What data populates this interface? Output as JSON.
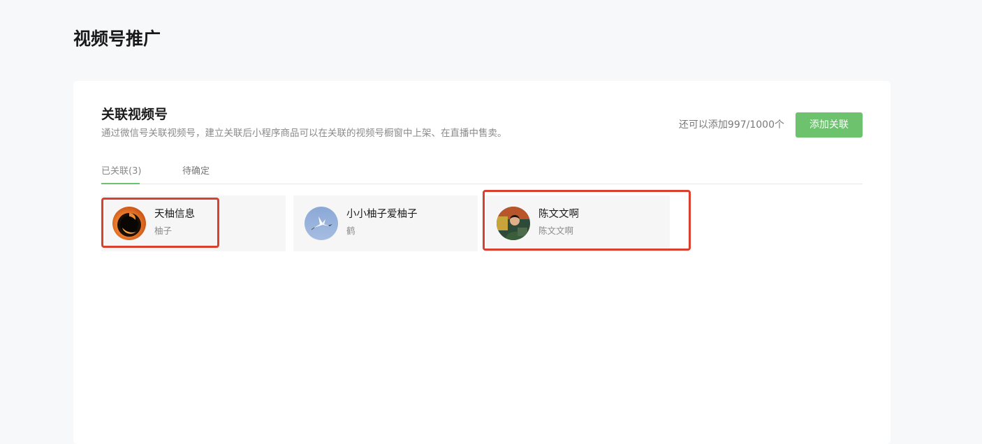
{
  "page": {
    "title": "视频号推广"
  },
  "section": {
    "title": "关联视频号",
    "description": "通过微信号关联视频号，建立关联后小程序商品可以在关联的视频号橱窗中上架、在直播中售卖。",
    "quota_text": "还可以添加997/1000个",
    "add_button_label": "添加关联"
  },
  "tabs": [
    {
      "label": "已关联(3)",
      "active": true
    },
    {
      "label": "待确定",
      "active": false
    }
  ],
  "accounts": [
    {
      "name": "天柚信息",
      "subtitle": "柚子",
      "avatar": "orange-fruit-avatar",
      "highlighted": true
    },
    {
      "name": "小小柚子爱柚子",
      "subtitle": "鹤",
      "avatar": "crane-sky-avatar",
      "highlighted": false
    },
    {
      "name": "陈文文啊",
      "subtitle": "陈文文啊",
      "avatar": "person-photo-avatar",
      "highlighted": true
    }
  ],
  "colors": {
    "accent_green": "#6cc26d",
    "highlight_red": "#d9402e",
    "card_bg": "#f6f6f6",
    "page_bg": "#f7f8fa"
  }
}
